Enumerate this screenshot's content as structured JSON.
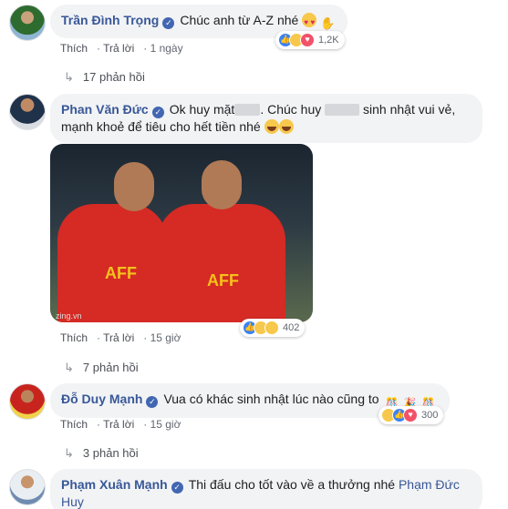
{
  "comments": [
    {
      "author": "Trần Đình Trọng",
      "text": "Chúc anh từ A-Z nhé",
      "actions": {
        "like": "Thích",
        "reply": "Trả lời",
        "time": "1 ngày"
      },
      "reactions_count": "1,2K",
      "replies": "17 phản hồi"
    },
    {
      "author": "Phan Văn Đức",
      "text_part1": "Ok huy mặt",
      "text_part2": ". Chúc huy",
      "text_part3": "sinh nhật vui vẻ,",
      "text_line2": "mạnh khoẻ để tiêu cho hết tiền nhé",
      "photo": {
        "jersey": "AFF",
        "watermark": "zing.vn"
      },
      "actions": {
        "like": "Thích",
        "reply": "Trả lời",
        "time": "15 giờ"
      },
      "reactions_count": "402",
      "replies": "7 phản hồi"
    },
    {
      "author": "Đỗ Duy Mạnh",
      "text": "Vua có khác sinh nhật lúc nào cũng to",
      "actions": {
        "like": "Thích",
        "reply": "Trả lời",
        "time": "15 giờ"
      },
      "reactions_count": "300",
      "replies": "3 phản hồi"
    },
    {
      "author": "Phạm Xuân Mạnh",
      "text": "Thi đấu cho tốt vào về a thưởng nhé",
      "mention_line1": "Phạm Đức",
      "mention_line2": "Huy"
    }
  ],
  "colors": {
    "link": "#385898",
    "bubble": "#f2f3f5",
    "like": "#3b82f6",
    "love": "#f25268",
    "haha": "#f7c84b"
  }
}
